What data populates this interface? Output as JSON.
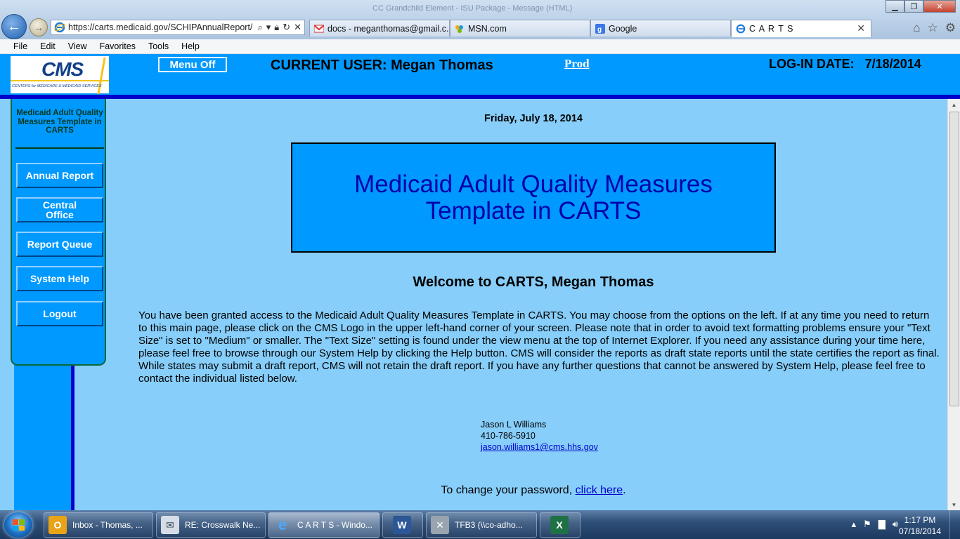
{
  "browser": {
    "titlebar_text": "CC Grandchild Element - ISU Package - Message (HTML)",
    "url": "https://carts.medicaid.gov/SCHIPAnnualReport/",
    "tabs": [
      {
        "label": "docs - meganthomas@gmail.c...",
        "icon": "gmail-icon",
        "active": false
      },
      {
        "label": "MSN.com",
        "icon": "msn-icon",
        "active": false
      },
      {
        "label": "Google",
        "icon": "google-icon",
        "active": false
      },
      {
        "label": "C A R T S",
        "icon": "ie-icon",
        "active": true
      }
    ],
    "menu": [
      "File",
      "Edit",
      "View",
      "Favorites",
      "Tools",
      "Help"
    ]
  },
  "header": {
    "logo_text": "CMS",
    "logo_subtext": "CENTERS for MEDICARE & MEDICAID SERVICES",
    "menu_off_label": "Menu Off",
    "current_user": "CURRENT USER: Megan Thomas",
    "environment_link": "Prod",
    "login_date": "LOG-IN DATE:   7/18/2014"
  },
  "nav": {
    "title": "Medicaid Adult Quality Measures Template in CARTS",
    "buttons": [
      "Annual Report",
      "Central Office",
      "Report Queue",
      "System Help",
      "Logout"
    ]
  },
  "main": {
    "date": "Friday, July 18, 2014",
    "banner_title": "Medicaid Adult Quality Measures Template in CARTS",
    "welcome": "Welcome to CARTS, Megan Thomas",
    "intro": "You have been granted access to the Medicaid Adult Quality Measures Template in CARTS. You may choose from the options on the left. If at any time you need to return to this main page, please click on the CMS Logo in the upper left-hand corner of your screen. Please note that in order to avoid text formatting problems ensure your \"Text Size\" is set to \"Medium\" or smaller. The \"Text Size\" setting is found under the view menu at the top of Internet Explorer. If you need any assistance during your time here, please feel free to browse through our System Help by clicking the Help button. CMS will consider the reports as draft state reports until the state certifies the report as final. While states may submit a draft report, CMS will not retain the draft report. If you have any further questions that cannot be answered by System Help, please feel free to contact the individual listed below.",
    "contact": {
      "name": "Jason L Williams",
      "phone": "410-786-5910",
      "email": "jason.williams1@cms.hhs.gov"
    },
    "password_prefix": "To change your password,",
    "password_link": "click here",
    "password_suffix": "."
  },
  "taskbar": {
    "tasks": [
      {
        "label": "Inbox - Thomas, ...",
        "icon": "outlook-icon"
      },
      {
        "label": "RE: Crosswalk Ne...",
        "icon": "email-message-icon"
      },
      {
        "label": "C A R T S - Windo...",
        "icon": "ie-icon"
      },
      {
        "label": "",
        "icon": "word-icon"
      },
      {
        "label": "TFB3 (\\\\co-adho...",
        "icon": "network-drive-icon"
      },
      {
        "label": "",
        "icon": "excel-icon"
      }
    ],
    "time": "1:17 PM",
    "date": "07/18/2014"
  },
  "colors": {
    "header_blue": "#0099ff",
    "page_background": "#87cefa",
    "accent_navy": "#0000cc",
    "banner_text": "#0000aa"
  }
}
